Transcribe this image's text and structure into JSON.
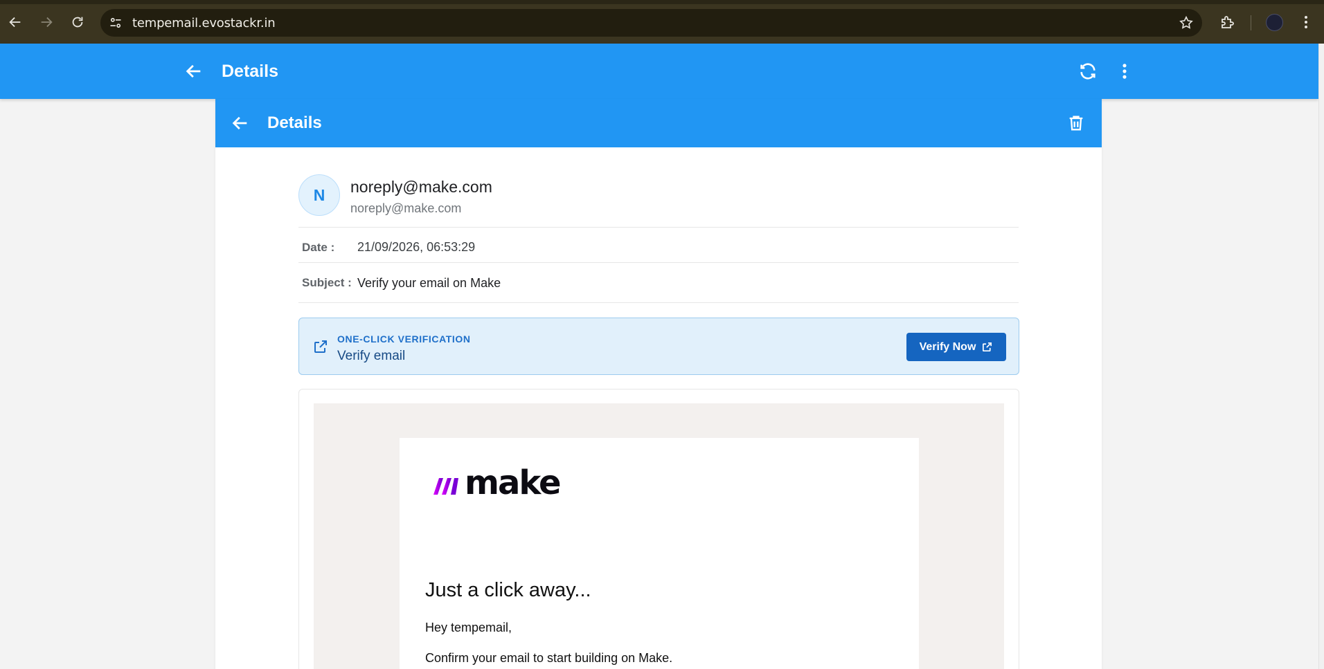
{
  "browser": {
    "url": "tempemail.evostackr.in"
  },
  "app_header": {
    "title": "Details"
  },
  "card": {
    "title": "Details"
  },
  "sender": {
    "initial": "N",
    "name": "noreply@make.com",
    "email": "noreply@make.com"
  },
  "meta": {
    "date_label": "Date :",
    "date_value": "21/09/2026, 06:53:29",
    "subject_label": "Subject :",
    "subject_value": "Verify your email on Make"
  },
  "verification": {
    "kicker": "ONE-CLICK VERIFICATION",
    "text": "Verify email",
    "button_label": "Verify Now"
  },
  "email_body": {
    "brand": "make",
    "heading": "Just a click away...",
    "greeting": "Hey tempemail,",
    "line1": "Confirm your email to start building on Make."
  },
  "icons": {
    "back": "arrow-left-icon",
    "forward": "arrow-right-icon",
    "reload": "reload-icon",
    "site_info": "tune-icon",
    "bookmark": "star-icon",
    "extensions": "puzzle-icon",
    "profile": "avatar",
    "browser_menu": "more-vertical-icon",
    "refresh": "refresh-icon",
    "more": "more-vertical-icon",
    "delete": "trash-icon",
    "external": "external-link-icon"
  },
  "colors": {
    "primary": "#2196f3",
    "verify_button": "#1565c0",
    "verify_bg": "#e1f0fb",
    "browser_frame": "#3b3520"
  }
}
